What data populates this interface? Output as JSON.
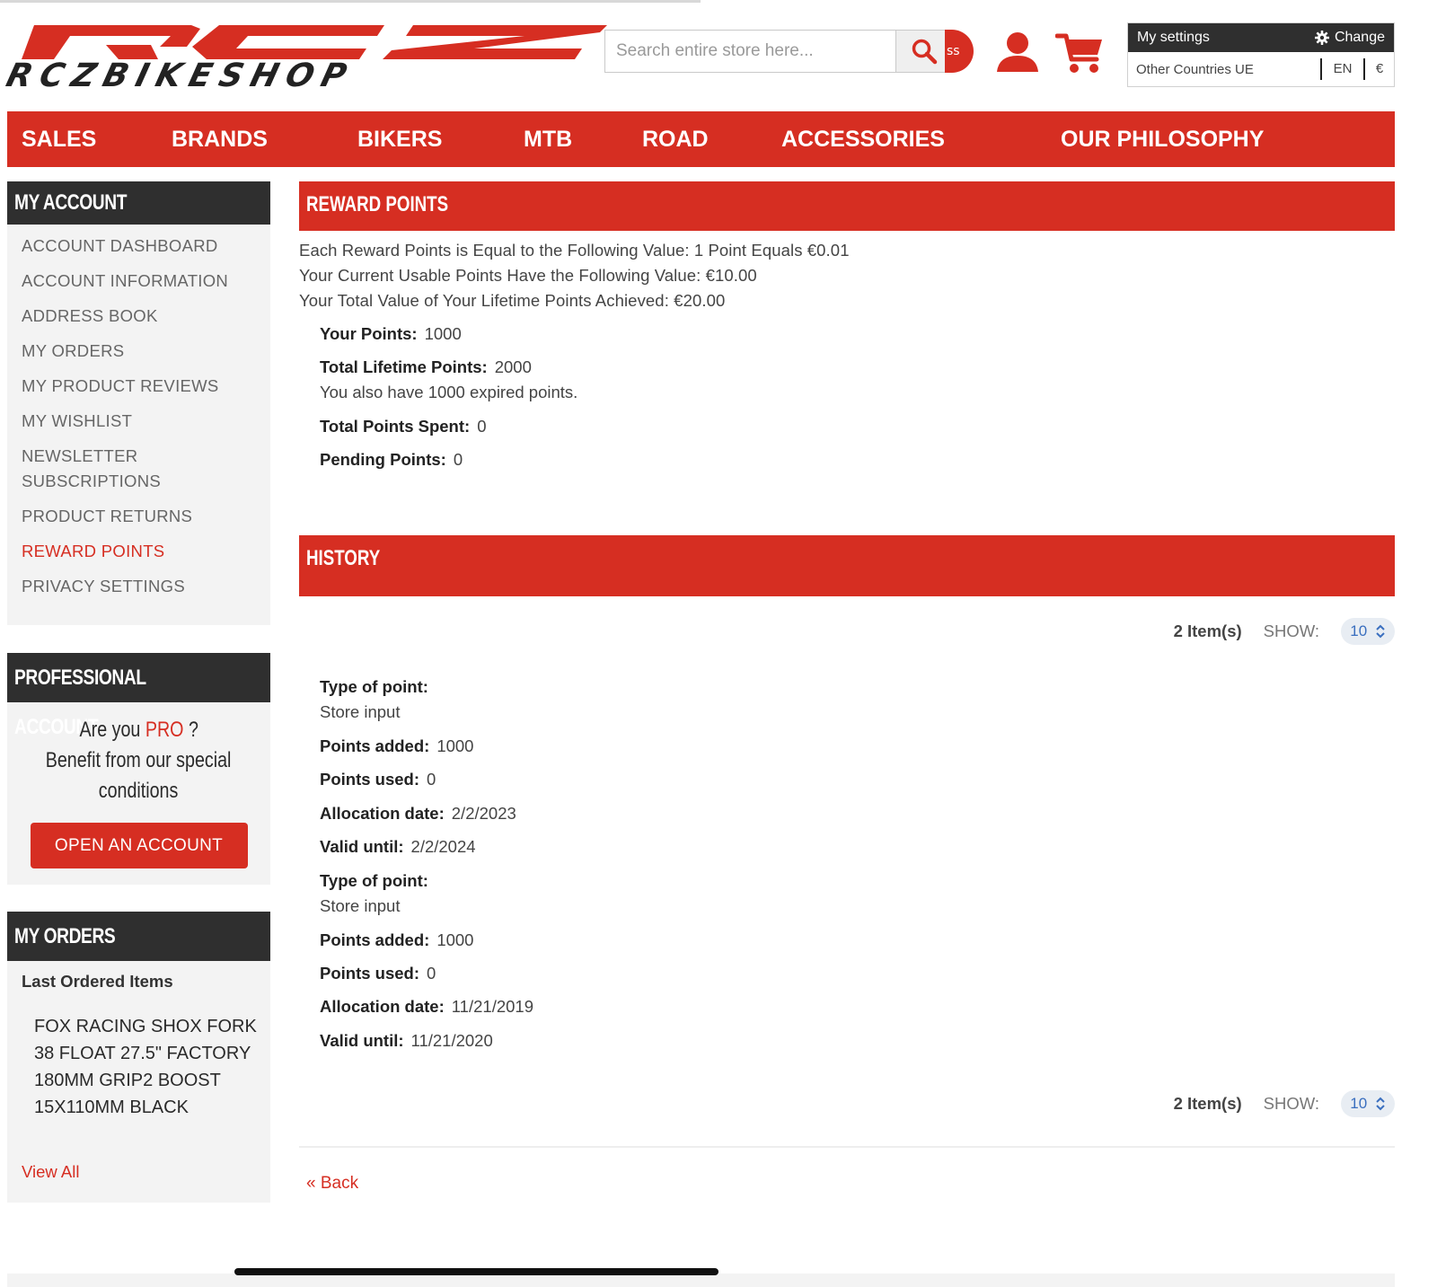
{
  "header": {
    "brand_name": "RCZBIKESHOP",
    "brand_mark": "RCZ",
    "search": {
      "placeholder": "Search entire store here...",
      "tail_text": "ss"
    },
    "settings": {
      "title": "My settings",
      "change_label": "Change",
      "country": "Other Countries UE",
      "language": "EN",
      "currency": "€"
    }
  },
  "nav": {
    "items": [
      "SALES",
      "BRANDS",
      "BIKERS",
      "MTB",
      "ROAD",
      "ACCESSORIES",
      "OUR PHILOSOPHY"
    ]
  },
  "sidebar": {
    "account": {
      "title": "MY ACCOUNT",
      "items": [
        "ACCOUNT DASHBOARD",
        "ACCOUNT INFORMATION",
        "ADDRESS BOOK",
        "MY ORDERS",
        "MY PRODUCT REVIEWS",
        "MY WISHLIST",
        "NEWSLETTER SUBSCRIPTIONS",
        "PRODUCT RETURNS",
        "REWARD POINTS",
        "PRIVACY SETTINGS"
      ],
      "active_item": "REWARD POINTS"
    },
    "pro": {
      "title": "PROFESSIONAL ACCOUNT",
      "question_prefix": "Are you",
      "question_highlight": "PRO",
      "question_suffix": "?",
      "line2": "Benefit from our special",
      "line3": "conditions",
      "button": "OPEN AN ACCOUNT"
    },
    "orders": {
      "title": "MY ORDERS",
      "subtitle": "Last Ordered Items",
      "item": "FOX RACING SHOX FORK 38 FLOAT 27.5\" FACTORY 180MM GRIP2 BOOST 15X110MM BLACK",
      "view_all": "View All"
    }
  },
  "reward": {
    "title": "REWARD POINTS",
    "info": [
      "Each Reward Points is Equal to the Following Value: 1 Point Equals €0.01",
      "Your Current Usable Points Have the Following Value: €10.00",
      "Your Total Value of Your Lifetime Points Achieved: €20.00"
    ],
    "your_points_label": "Your Points:",
    "your_points": "1000",
    "lifetime_label": "Total Lifetime Points:",
    "lifetime": "2000",
    "expired_note": "You also have 1000 expired points.",
    "spent_label": "Total Points Spent:",
    "spent": "0",
    "pending_label": "Pending Points:",
    "pending": "0"
  },
  "history": {
    "title": "HISTORY",
    "count": "2 Item(s)",
    "show_label": "SHOW:",
    "show_value": "10",
    "labels": {
      "type": "Type of point:",
      "added": "Points added:",
      "used": "Points used:",
      "allocation": "Allocation date:",
      "valid": "Valid until:"
    },
    "entries": [
      {
        "type": "Store input",
        "added": "1000",
        "used": "0",
        "allocation": "2/2/2023",
        "valid": "2/2/2024"
      },
      {
        "type": "Store input",
        "added": "1000",
        "used": "0",
        "allocation": "11/21/2019",
        "valid": "11/21/2020"
      }
    ],
    "back": "« Back"
  },
  "colors": {
    "accent": "#d62e22",
    "dark": "#2f2f2f",
    "sidebar_bg": "#f3f3f3"
  },
  "icons": [
    "search-icon",
    "account-icon",
    "cart-icon",
    "gear-icon",
    "chevron-updown-icon"
  ]
}
